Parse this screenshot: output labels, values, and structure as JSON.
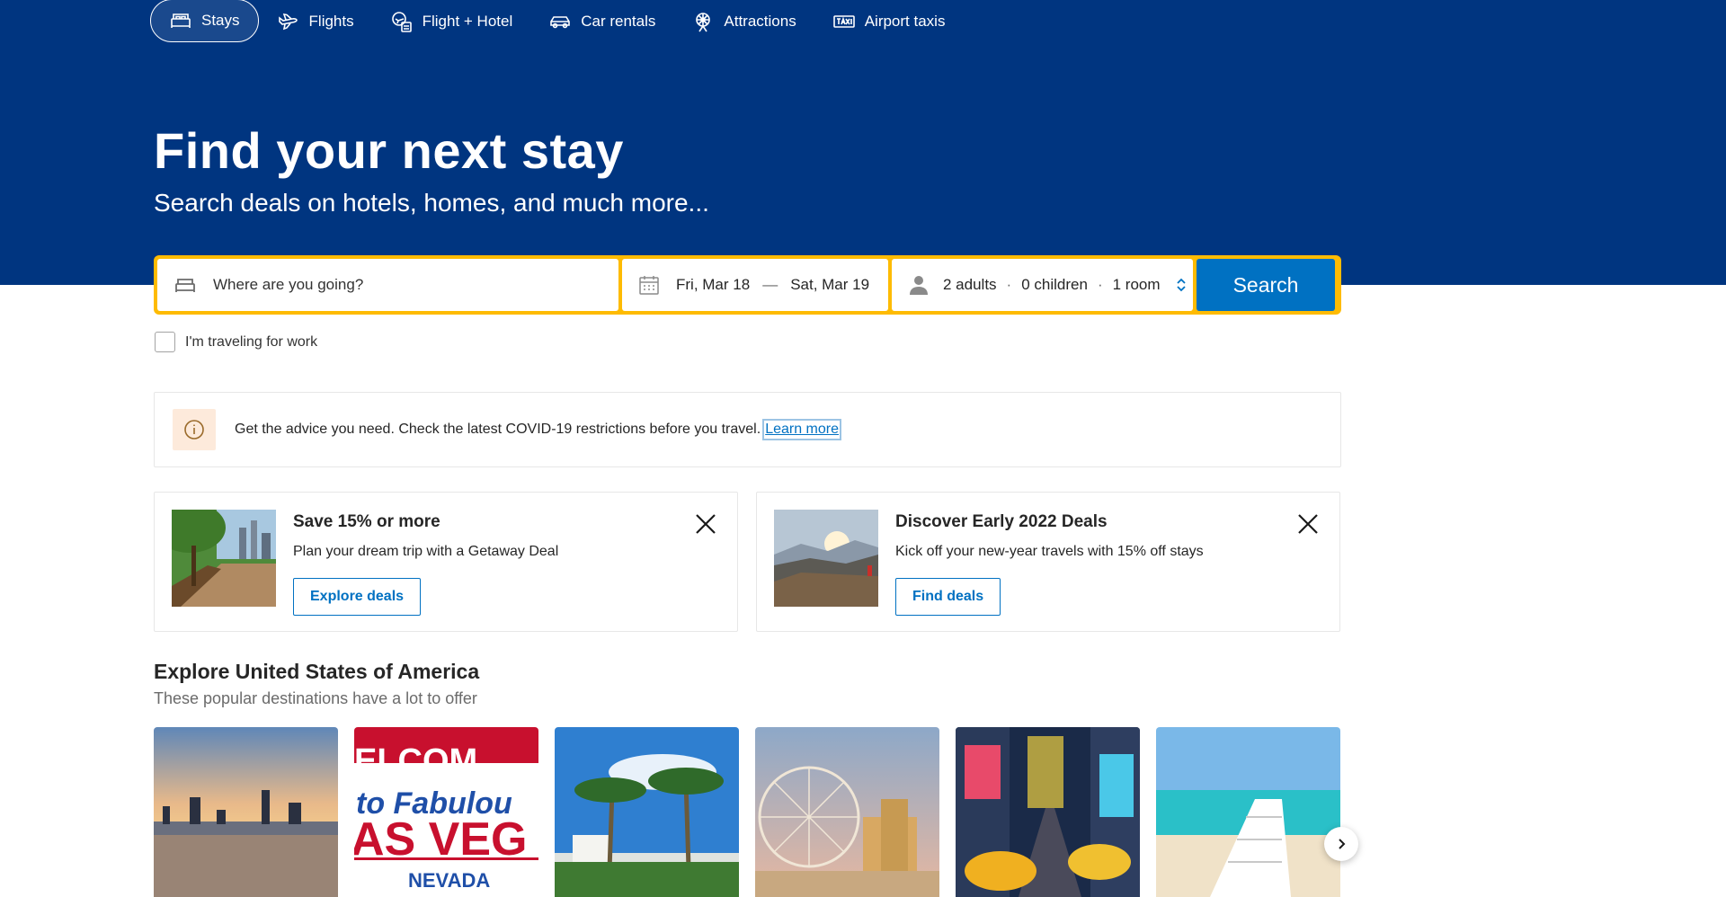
{
  "nav": {
    "items": [
      {
        "label": "Stays",
        "icon": "bed-icon",
        "active": true
      },
      {
        "label": "Flights",
        "icon": "plane-icon"
      },
      {
        "label": "Flight + Hotel",
        "icon": "flight-hotel-icon"
      },
      {
        "label": "Car rentals",
        "icon": "car-icon"
      },
      {
        "label": "Attractions",
        "icon": "attractions-icon"
      },
      {
        "label": "Airport taxis",
        "icon": "taxi-icon"
      }
    ]
  },
  "hero": {
    "title": "Find your next stay",
    "subtitle": "Search deals on hotels, homes, and much more..."
  },
  "search": {
    "destination_placeholder": "Where are you going?",
    "checkin": "Fri, Mar 18",
    "date_separator": "—",
    "checkout": "Sat, Mar 19",
    "adults": "2 adults",
    "children": "0 children",
    "rooms": "1 room",
    "dot": "·",
    "button_label": "Search",
    "accent": "#febb02",
    "button_color": "#0071c2"
  },
  "work_travel": {
    "label": "I'm traveling for work",
    "checked": false
  },
  "covid": {
    "text": "Get the advice you need. Check the latest COVID-19 restrictions before you travel.",
    "link": "Learn more"
  },
  "promos": [
    {
      "title": "Save 15% or more",
      "subtitle": "Plan your dream trip with a Getaway Deal",
      "button": "Explore deals"
    },
    {
      "title": "Discover Early 2022 Deals",
      "subtitle": "Kick off your new-year travels with 15% off stays",
      "button": "Find deals"
    }
  ],
  "explore": {
    "title": "Explore United States of America",
    "subtitle": "These popular destinations have a lot to offer"
  },
  "destination_cards": [
    {
      "image": "lake-skyline-sunset"
    },
    {
      "image": "welcome-sign",
      "sign_text": [
        "ELCOM",
        "to Fabulou",
        "AS VEG",
        "NEVADA"
      ]
    },
    {
      "image": "palm-trees"
    },
    {
      "image": "ferris-wheel"
    },
    {
      "image": "times-square"
    },
    {
      "image": "beach-boardwalk"
    }
  ],
  "colors": {
    "brand": "#003580",
    "link": "#0071c2"
  }
}
